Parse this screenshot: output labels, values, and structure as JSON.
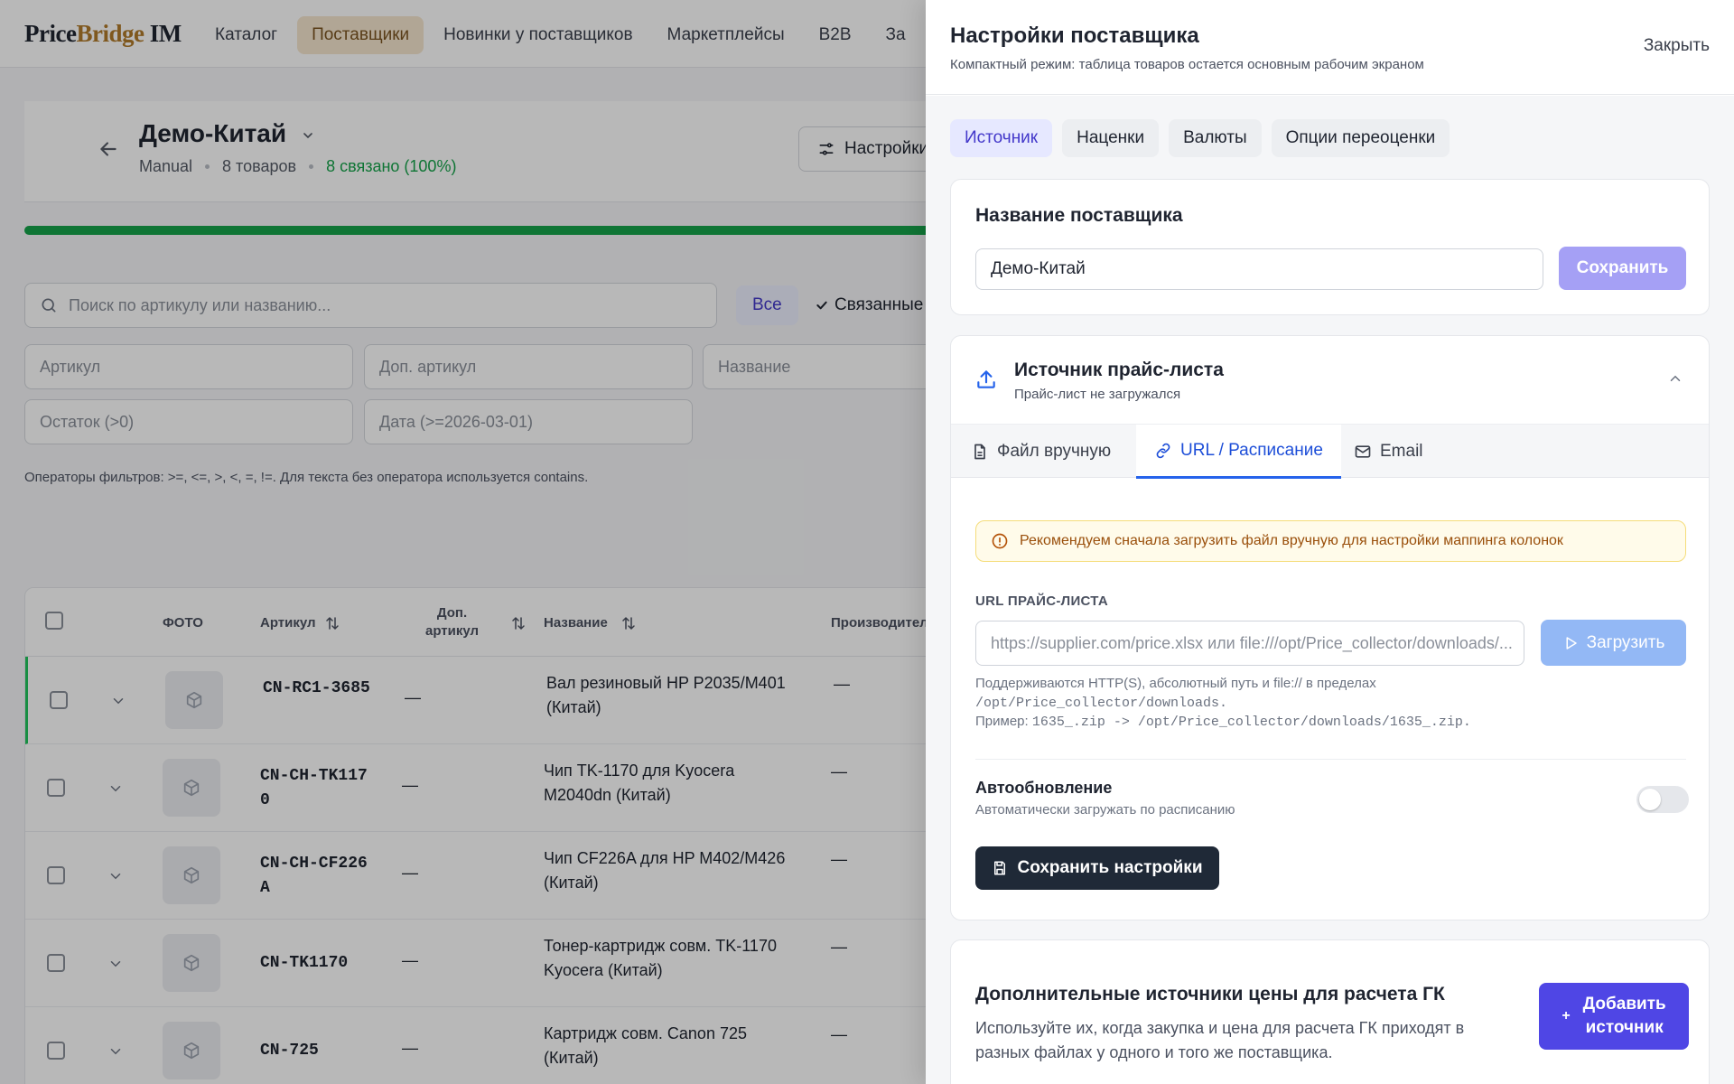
{
  "app": {
    "logo_prefix": "Price",
    "logo_brand": "Bridge",
    "logo_suffix": " IM"
  },
  "nav": {
    "items": [
      "Каталог",
      "Поставщики",
      "Новинки у поставщиков",
      "Маркетплейсы",
      "B2B",
      "За"
    ]
  },
  "supplier": {
    "title": "Демо-Китай",
    "type": "Manual",
    "count": "8 товаров",
    "linked": "8 связано (100%)",
    "settings_button": "Настройки",
    "progress_percent": 100
  },
  "search": {
    "placeholder": "Поиск по артикулу или названию...",
    "seg_all": "Все",
    "seg_linked": "Связанные"
  },
  "filters": {
    "sku": "Артикул",
    "extra_sku": "Доп. артикул",
    "name": "Название",
    "stock": "Остаток (>0)",
    "date": "Дата (>=2026-03-01)",
    "hint": "Операторы фильтров: >=, <=, >, <, =, !=. Для текста без оператора используется contains."
  },
  "table": {
    "headers": {
      "photo": "ФОТО",
      "sku": "Артикул",
      "extra_sku_1": "Доп.",
      "extra_sku_2": "артикул",
      "name": "Название",
      "maker": "Производитель"
    },
    "rows": [
      {
        "sku": "CN-RC1-3685",
        "extra": "—",
        "name": "Вал резиновый HP P2035/M401 (Китай)",
        "maker": "—"
      },
      {
        "sku": "CN-CH-TK1170",
        "extra": "—",
        "name": "Чип TK-1170 для Kyocera M2040dn (Китай)",
        "maker": "—"
      },
      {
        "sku": "CN-CH-CF226A",
        "extra": "—",
        "name": "Чип CF226A для HP M402/M426 (Китай)",
        "maker": "—"
      },
      {
        "sku": "CN-TK1170",
        "extra": "—",
        "name": "Тонер-картридж совм. TK-1170 Kyocera (Китай)",
        "maker": "—"
      },
      {
        "sku": "CN-725",
        "extra": "—",
        "name": "Картридж совм. Canon 725 (Китай)",
        "maker": "—"
      }
    ]
  },
  "drawer": {
    "title": "Настройки поставщика",
    "subtitle": "Компактный режим: таблица товаров остается основным рабочим экраном",
    "close": "Закрыть",
    "tabs": [
      "Источник",
      "Наценки",
      "Валюты",
      "Опции переоценки"
    ],
    "name_section": {
      "label": "Название поставщика",
      "value": "Демо-Китай",
      "save": "Сохранить"
    },
    "source": {
      "title": "Источник прайс-листа",
      "subtitle": "Прайс-лист не загружался",
      "subtabs": [
        "Файл вручную",
        "URL / Расписание",
        "Email"
      ],
      "warning": "Рекомендуем сначала загрузить файл вручную для настройки маппинга колонок",
      "url_label": "URL ПРАЙС-ЛИСТА",
      "url_placeholder": "https://supplier.com/price.xlsx или file:///opt/Price_collector/downloads/...",
      "load": "Загрузить",
      "hint_text": "Поддерживаются HTTP(S), абсолютный путь и file:// в пределах",
      "hint_path": "/opt/Price_collector/downloads.",
      "example_label": "Пример:",
      "example_value": "1635_.zip -> /opt/Price_collector/downloads/1635_.zip.",
      "auto_title": "Автообновление",
      "auto_sub": "Автоматически загружать по расписанию",
      "save_settings": "Сохранить настройки"
    },
    "extra": {
      "title": "Дополнительные источники цены для расчета ГК",
      "subtitle": "Используйте их, когда закупка и цена для расчета ГК приходят в разных файлах у одного и того же поставщика.",
      "add_line1": "Добавить",
      "add_line2": "источник"
    }
  },
  "colors": {
    "accent": "#4f46e5",
    "success": "#16a34a",
    "warning_bg": "#fffbea",
    "warning_text": "#9a4f0b"
  }
}
